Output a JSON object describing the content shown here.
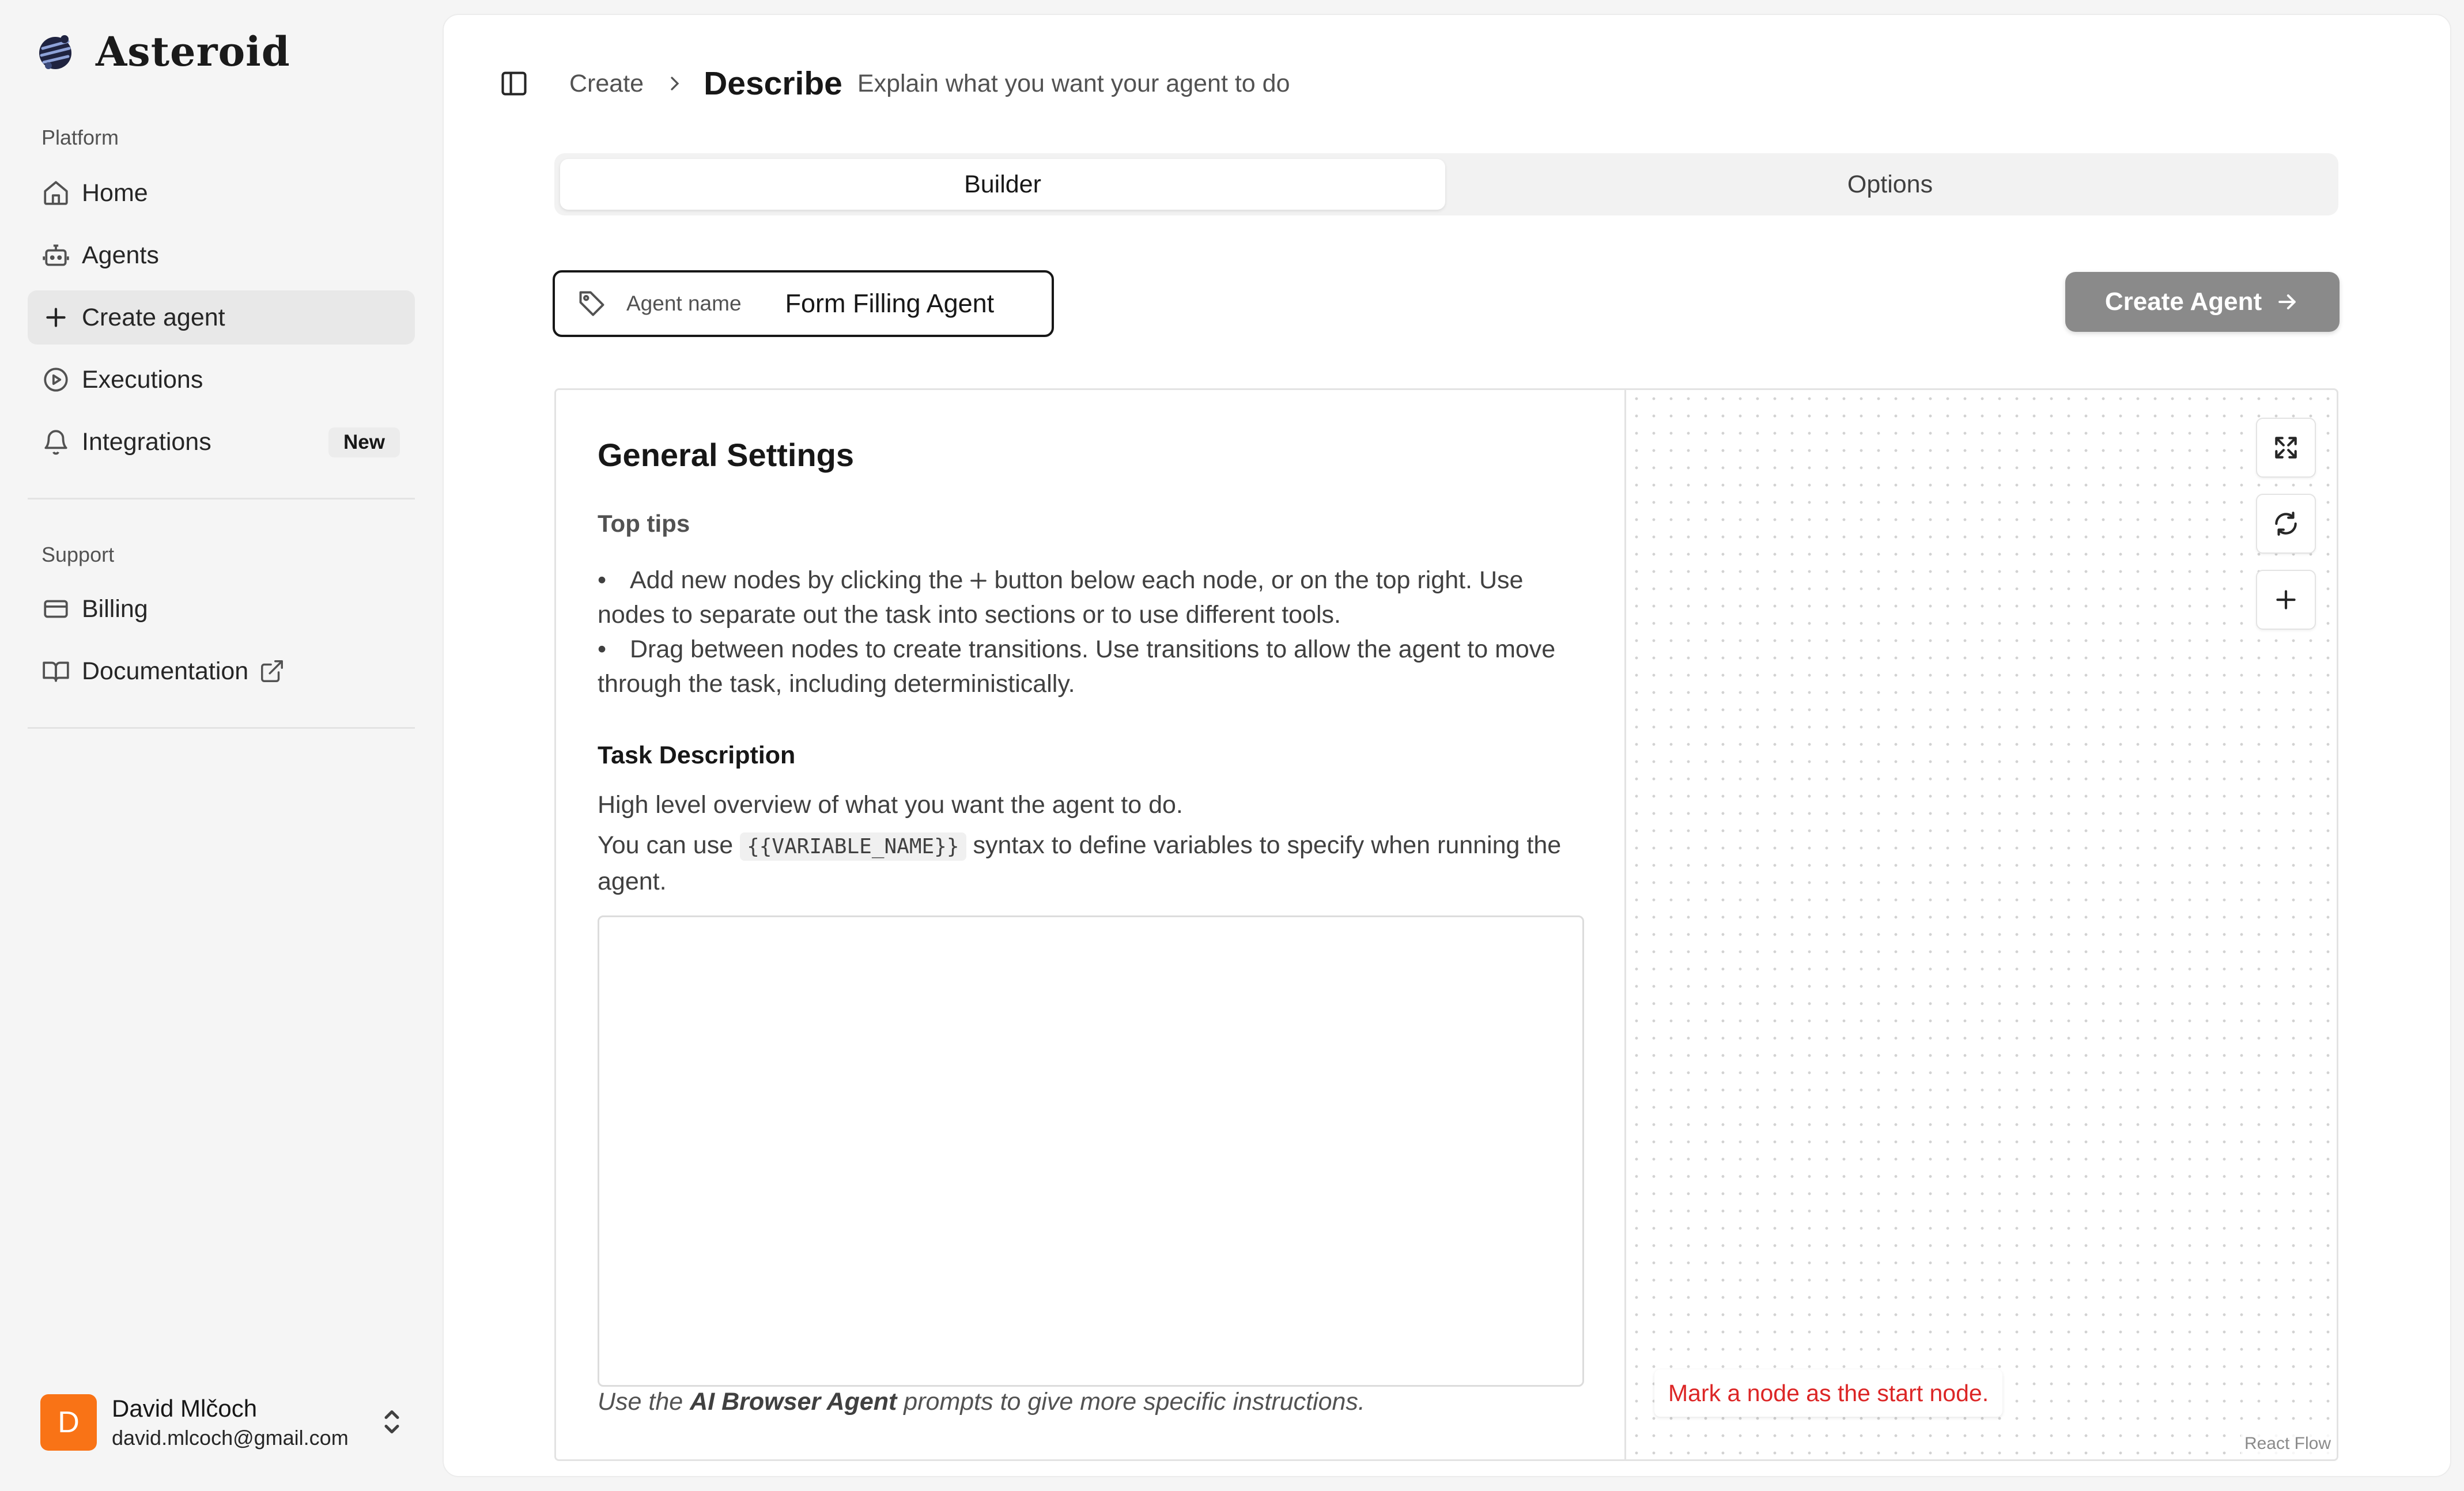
{
  "sidebar": {
    "brand": "Asteroid",
    "platform_label": "Platform",
    "platform_items": [
      {
        "label": "Home",
        "icon": "home-icon"
      },
      {
        "label": "Agents",
        "icon": "bot-icon"
      },
      {
        "label": "Create agent",
        "icon": "plus-icon",
        "active": true
      },
      {
        "label": "Executions",
        "icon": "play-circle-icon"
      },
      {
        "label": "Integrations",
        "icon": "bell-icon",
        "badge": "New"
      }
    ],
    "support_label": "Support",
    "support_items": [
      {
        "label": "Billing",
        "icon": "credit-card-icon"
      },
      {
        "label": "Documentation",
        "icon": "book-icon",
        "external": true
      }
    ],
    "user": {
      "initial": "D",
      "name": "David Mlčoch",
      "email": "david.mlcoch@gmail.com"
    }
  },
  "header": {
    "crumb_parent": "Create",
    "title": "Describe",
    "description": "Explain what you want your agent to do"
  },
  "tabs": [
    {
      "label": "Builder",
      "active": true
    },
    {
      "label": "Options",
      "active": false
    }
  ],
  "agent_name": {
    "label": "Agent name",
    "value": "Form Filling Agent"
  },
  "create_button": "Create Agent",
  "settings": {
    "title": "General Settings",
    "tips_title": "Top tips",
    "tip1_before": "Add new nodes by clicking the",
    "tip1_after": "button below each node, or on the top right. Use nodes to separate out the task into sections or to use different tools.",
    "tip2": "Drag between nodes to create transitions. Use transitions to allow the agent to move through the task, including deterministically.",
    "task_title": "Task Description",
    "task_overview": "High level overview of what you want the agent to do.",
    "vars_before": "You can use",
    "vars_code": "{{VARIABLE_NAME}}",
    "vars_after": "syntax to define variables to specify when running the agent.",
    "task_value": "",
    "hint_before": "Use the",
    "hint_bold": "AI Browser Agent",
    "hint_after": "prompts to give more specific instructions."
  },
  "canvas": {
    "start_warning": "Mark a node as the start node.",
    "attribution": "React Flow"
  },
  "colors": {
    "accent_avatar": "#f97316",
    "warning": "#dc2626",
    "button_disabled": "#8a8a8a"
  }
}
